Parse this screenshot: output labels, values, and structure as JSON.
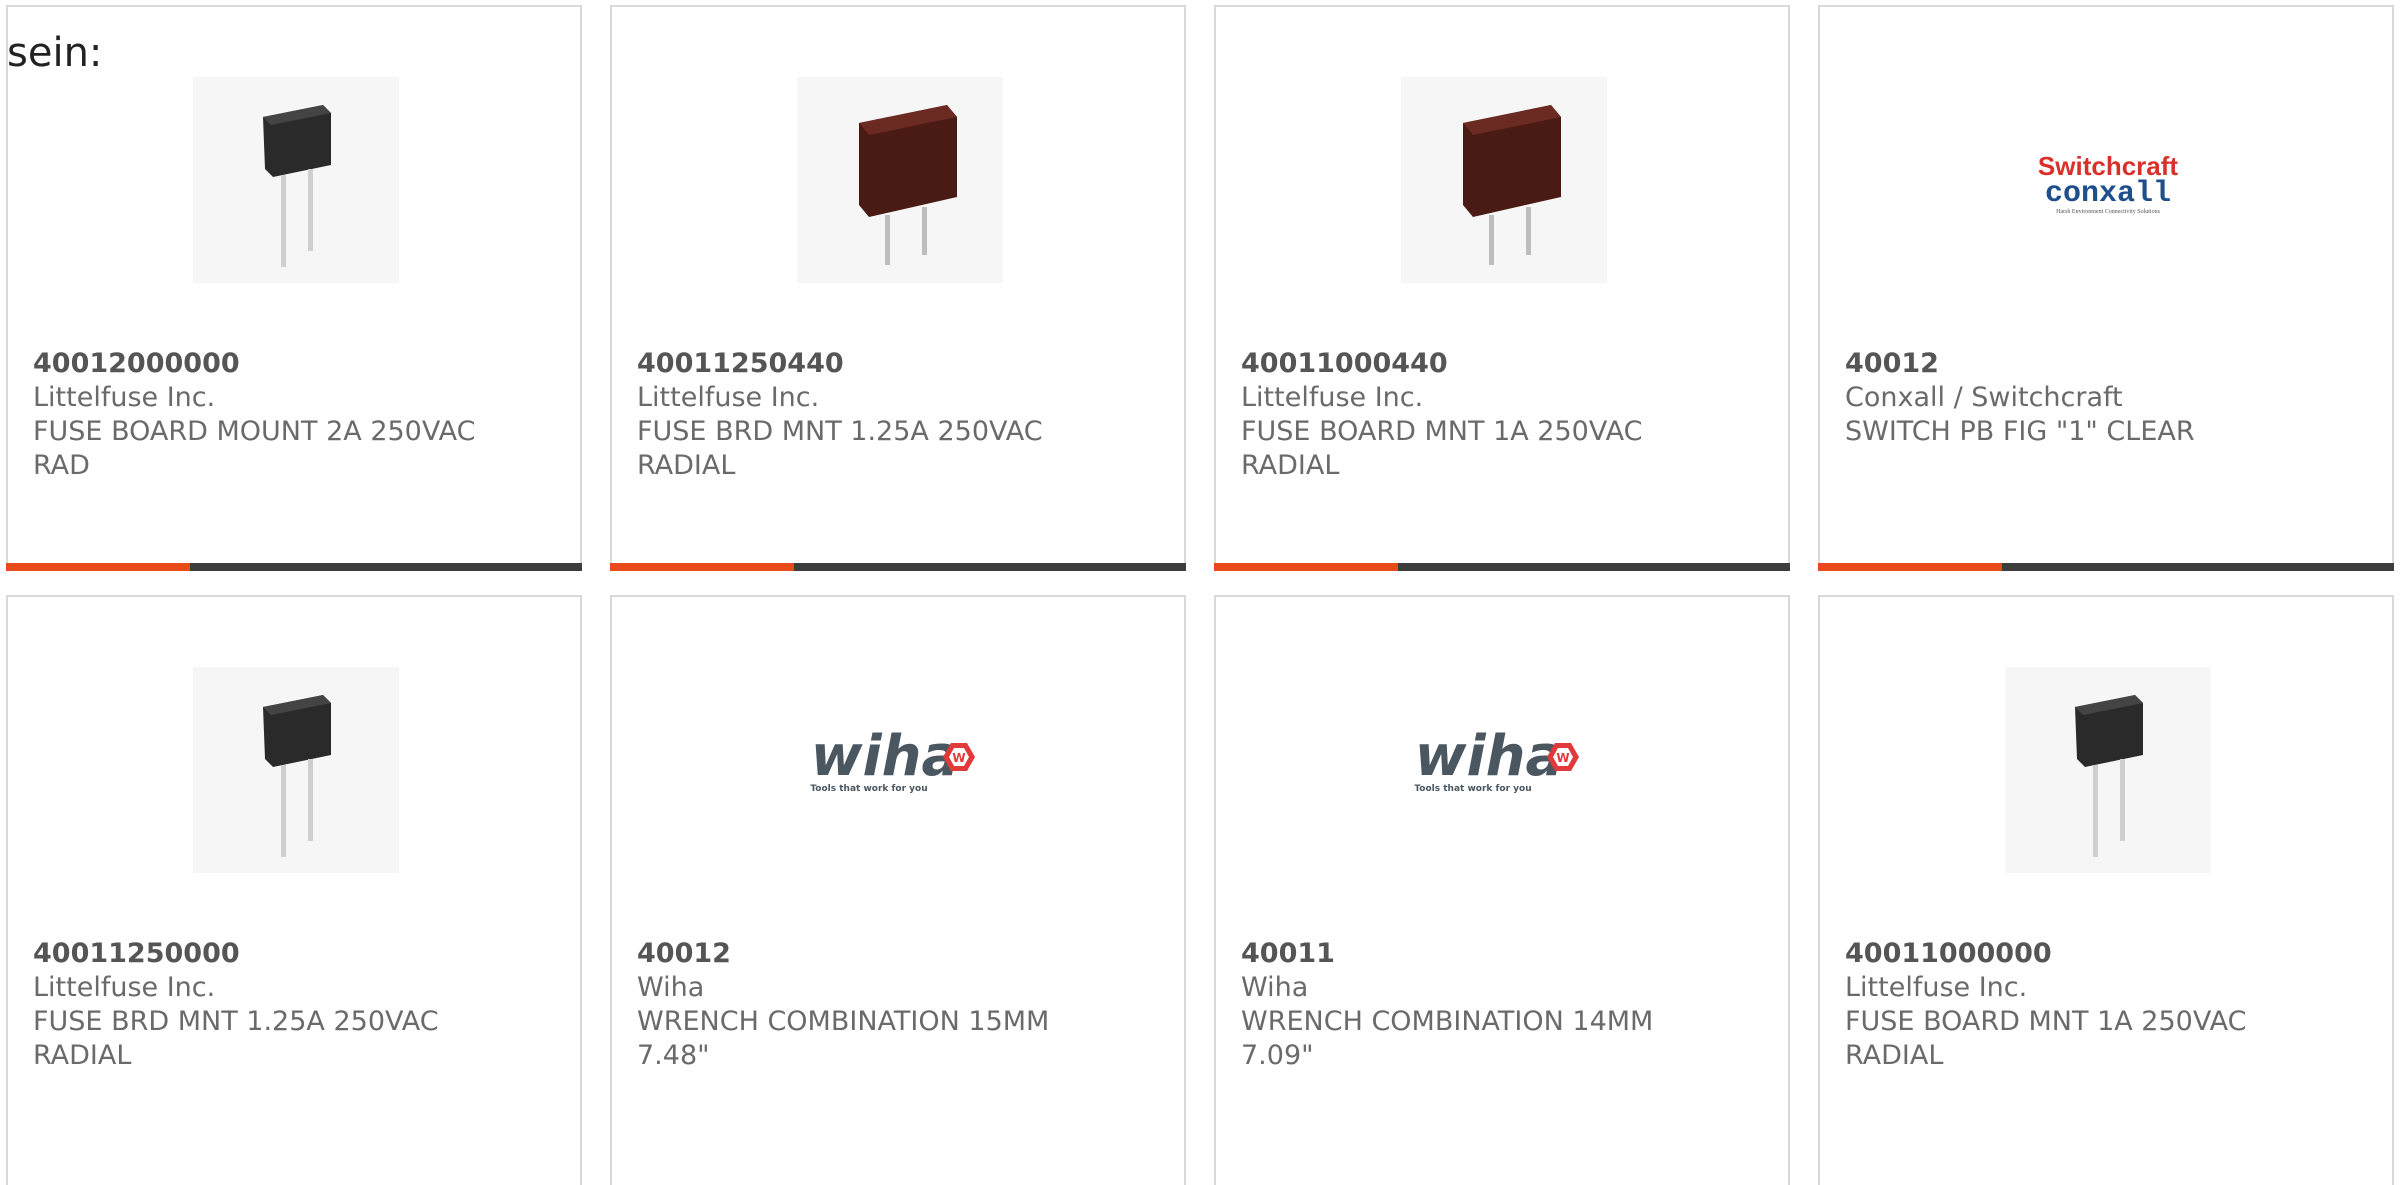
{
  "intro_text": "sein:",
  "colors": {
    "accent_bar": "#e84a1a",
    "bar_dark": "#3d3d3d",
    "border": "#d9d9d9",
    "text": "#6a6a6a"
  },
  "products": [
    {
      "part_number": "40012000000",
      "manufacturer": "Littelfuse Inc.",
      "description": "FUSE BOARD MOUNT 2A 250VAC RAD",
      "image": "black-radial-fuse"
    },
    {
      "part_number": "40011250440",
      "manufacturer": "Littelfuse Inc.",
      "description": "FUSE BRD MNT 1.25A 250VAC RADIAL",
      "image": "brown-radial-fuse"
    },
    {
      "part_number": "40011000440",
      "manufacturer": "Littelfuse Inc.",
      "description": "FUSE BOARD MNT 1A 250VAC RADIAL",
      "image": "brown-radial-fuse"
    },
    {
      "part_number": "40012",
      "manufacturer": "Conxall / Switchcraft",
      "description": "SWITCH PB FIG \"1\" CLEAR",
      "image": "switchcraft-conxall-logo",
      "logo": {
        "line1": "Switchcraft",
        "line2": "conxall",
        "tagline": "Harsh Environment Connectivity Solutions"
      }
    },
    {
      "part_number": "40011250000",
      "manufacturer": "Littelfuse Inc.",
      "description": "FUSE BRD MNT 1.25A 250VAC RADIAL",
      "image": "black-radial-fuse"
    },
    {
      "part_number": "40012",
      "manufacturer": "Wiha",
      "description": "WRENCH COMBINATION 15MM 7.48\"",
      "image": "wiha-logo",
      "logo": {
        "name": "wiha",
        "tagline": "Tools that work for you"
      }
    },
    {
      "part_number": "40011",
      "manufacturer": "Wiha",
      "description": "WRENCH COMBINATION 14MM 7.09\"",
      "image": "wiha-logo",
      "logo": {
        "name": "wiha",
        "tagline": "Tools that work for you"
      }
    },
    {
      "part_number": "40011000000",
      "manufacturer": "Littelfuse Inc.",
      "description": "FUSE BOARD MNT 1A 250VAC RADIAL",
      "image": "black-radial-fuse"
    }
  ]
}
